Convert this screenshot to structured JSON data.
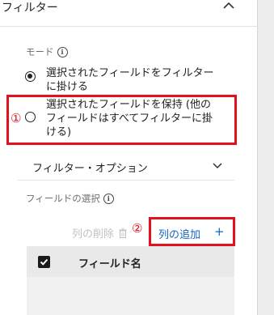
{
  "header": {
    "title": "フィルター"
  },
  "mode": {
    "label": "モード",
    "options": [
      {
        "line1": "選択されたフィールドをフィルター",
        "line2": "に掛ける",
        "selected": true
      },
      {
        "line1": "選択されたフィールドを保持 (他の",
        "line2": "フィールドはすべてフィルターに掛",
        "line3": "ける)",
        "selected": false
      }
    ]
  },
  "filter_options": {
    "label": "フィルター・オプション"
  },
  "field_select": {
    "label": "フィールドの選択",
    "delete_label": "列の削除",
    "add_label": "列の追加",
    "add_symbol": "+"
  },
  "table": {
    "header": "フィールド名"
  },
  "annotations": {
    "one": "①",
    "two": "②"
  },
  "colors": {
    "highlight": "#e0101f",
    "link": "#1565c0"
  }
}
